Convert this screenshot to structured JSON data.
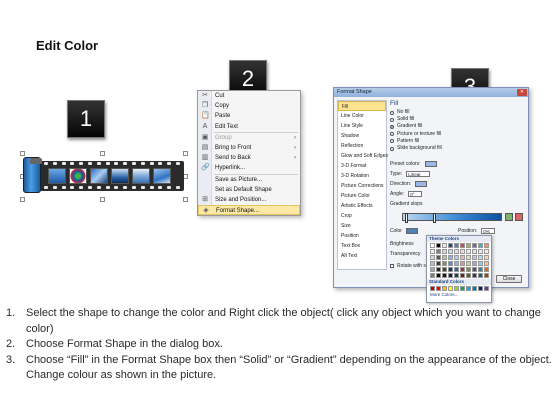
{
  "title": "Edit Color",
  "badges": [
    "1",
    "2",
    "3"
  ],
  "context_menu": {
    "items": [
      {
        "label": "Cut",
        "icon": "scissors-icon",
        "glyph": "✂",
        "disabled": false,
        "submenu": false
      },
      {
        "label": "Copy",
        "icon": "copy-icon",
        "glyph": "❐",
        "disabled": false,
        "submenu": false
      },
      {
        "label": "Paste",
        "icon": "paste-icon",
        "glyph": "📋",
        "disabled": false,
        "submenu": false
      },
      {
        "label": "Edit Text",
        "icon": "text-icon",
        "glyph": "A",
        "disabled": false,
        "submenu": false
      },
      {
        "label": "Group",
        "icon": "group-icon",
        "glyph": "▣",
        "disabled": true,
        "submenu": true
      },
      {
        "label": "Bring to Front",
        "icon": "bring-front-icon",
        "glyph": "▤",
        "disabled": false,
        "submenu": true
      },
      {
        "label": "Send to Back",
        "icon": "send-back-icon",
        "glyph": "▥",
        "disabled": false,
        "submenu": true
      },
      {
        "label": "Hyperlink...",
        "icon": "hyperlink-icon",
        "glyph": "🔗",
        "disabled": false,
        "submenu": false
      },
      {
        "label": "Save as Picture...",
        "icon": "",
        "glyph": "",
        "disabled": false,
        "submenu": false
      },
      {
        "label": "Set as Default Shape",
        "icon": "",
        "glyph": "",
        "disabled": false,
        "submenu": false
      },
      {
        "label": "Size and Position...",
        "icon": "size-icon",
        "glyph": "⊞",
        "disabled": false,
        "submenu": false
      },
      {
        "label": "Format Shape...",
        "icon": "format-shape-icon",
        "glyph": "◈",
        "disabled": false,
        "submenu": false,
        "highlight": true
      }
    ]
  },
  "dialog": {
    "title": "Format Shape",
    "close_glyph": "✕",
    "nav": [
      "Fill",
      "Line Color",
      "Line Style",
      "Shadow",
      "Reflection",
      "Glow and Soft Edges",
      "3-D Format",
      "3-D Rotation",
      "Picture Corrections",
      "Picture Color",
      "Artistic Effects",
      "Crop",
      "Size",
      "Position",
      "Text Box",
      "Alt Text"
    ],
    "pane_title": "Fill",
    "fill_options": [
      {
        "label": "No fill",
        "on": false
      },
      {
        "label": "Solid fill",
        "on": false
      },
      {
        "label": "Gradient fill",
        "on": true
      },
      {
        "label": "Picture or texture fill",
        "on": false
      },
      {
        "label": "Pattern fill",
        "on": false
      },
      {
        "label": "Slide background fill",
        "on": false
      }
    ],
    "preset_colors_label": "Preset colors:",
    "type_label": "Type:",
    "type_value": "Linear",
    "direction_label": "Direction:",
    "angle_label": "Angle:",
    "angle_value": "0°",
    "gradient_stops_label": "Gradient stops",
    "color_label": "Color",
    "position_label": "Position:",
    "position_value": "0%",
    "brightness_label": "Brightness",
    "transparency_label": "Transparency",
    "rotate_label": "Rotate with shape",
    "theme_colors_label": "Theme Colors",
    "standard_colors_label": "Standard Colors",
    "more_colors_label": "More Colors...",
    "close_button": "Close",
    "theme_colors": [
      "#ffffff",
      "#000000",
      "#eeece1",
      "#1f497d",
      "#4f81bd",
      "#c0504d",
      "#9bbb59",
      "#8064a2",
      "#4bacc6",
      "#f79646",
      "#f2f2f2",
      "#7f7f7f",
      "#ddd9c3",
      "#c6d9f0",
      "#dbe5f1",
      "#f2dcdb",
      "#ebf1dd",
      "#e5e0ec",
      "#dbeef3",
      "#fdeada",
      "#d8d8d8",
      "#595959",
      "#c4bd97",
      "#8db3e2",
      "#b8cce4",
      "#e5b9b7",
      "#d7e3bc",
      "#ccc1d9",
      "#b7dde8",
      "#fbd5b5",
      "#bfbfbf",
      "#3f3f3f",
      "#938953",
      "#548dd4",
      "#95b3d7",
      "#d99694",
      "#c3d69b",
      "#b2a2c7",
      "#92cddc",
      "#fac08f",
      "#a5a5a5",
      "#262626",
      "#494429",
      "#17365d",
      "#366092",
      "#953734",
      "#76923c",
      "#5f497a",
      "#31859b",
      "#e36c09",
      "#7f7f7f",
      "#0c0c0c",
      "#1d1b10",
      "#0f243e",
      "#244061",
      "#632423",
      "#4f6128",
      "#3f3151",
      "#205867",
      "#974806"
    ],
    "standard_colors": [
      "#c00000",
      "#ff0000",
      "#ffc000",
      "#ffff00",
      "#92d050",
      "#00b050",
      "#00b0f0",
      "#0070c0",
      "#002060",
      "#7030a0"
    ]
  },
  "instructions": [
    {
      "num": "1.",
      "text": "Select the shape to change the color and Right click the object( click any object which you want to change color)"
    },
    {
      "num": "2.",
      "text": "Choose Format Shape in the dialog box."
    },
    {
      "num": "3.",
      "text": "Choose “Fill” in the Format Shape box then “Solid” or “Gradient” depending on the appearance of the object. Change colour as shown in the picture."
    }
  ]
}
